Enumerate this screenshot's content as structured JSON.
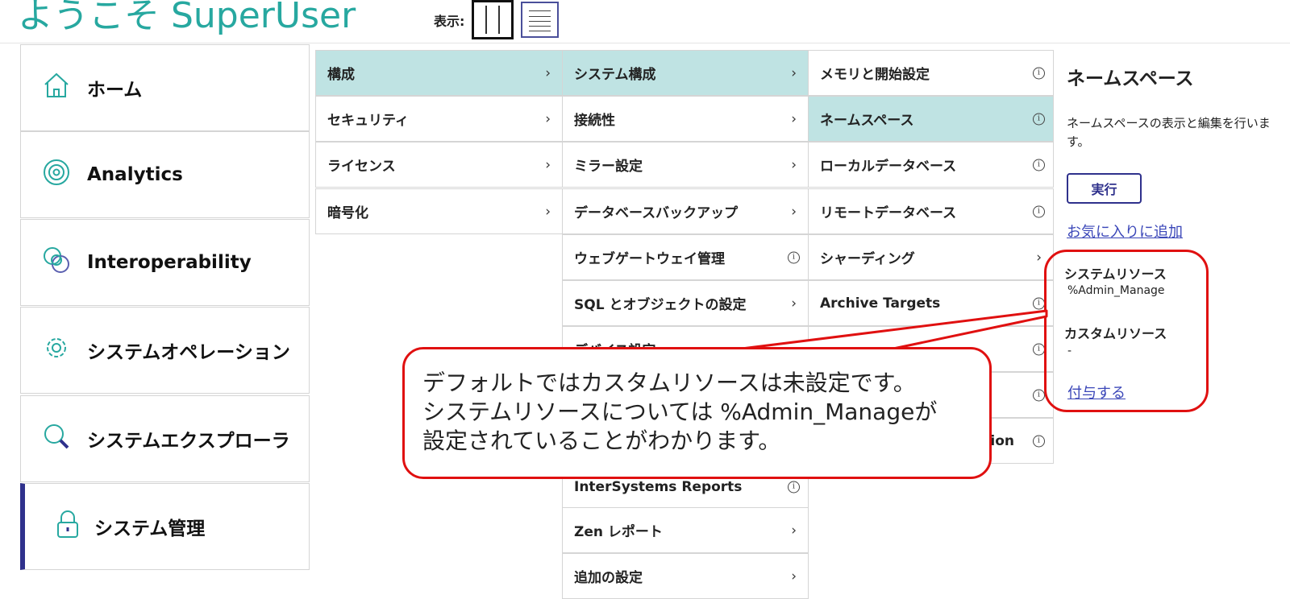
{
  "header": {
    "welcome": "ようこそ SuperUser",
    "view_label": "表示:"
  },
  "nav": [
    {
      "label": "ホーム",
      "icon": "home-icon"
    },
    {
      "label": "Analytics",
      "icon": "analytics-icon"
    },
    {
      "label": "Interoperability",
      "icon": "interoperability-icon"
    },
    {
      "label": "システムオペレーション",
      "icon": "gear-icon"
    },
    {
      "label": "システムエクスプローラ",
      "icon": "explorer-search-icon"
    },
    {
      "label": "システム管理",
      "icon": "lock-icon",
      "active": true
    }
  ],
  "col1": [
    {
      "label": "構成",
      "selected": true
    },
    {
      "label": "セキュリティ"
    },
    {
      "label": "ライセンス"
    },
    {
      "label": "暗号化"
    }
  ],
  "col2": [
    {
      "label": "システム構成",
      "selected": true
    },
    {
      "label": "接続性"
    },
    {
      "label": "ミラー設定"
    },
    {
      "label": "データベースバックアップ"
    },
    {
      "label": "ウェブゲートウェイ管理"
    },
    {
      "label": "SQL とオブジェクトの設定"
    },
    {
      "label": "デバイス設定"
    },
    {
      "label": ""
    },
    {
      "label": ""
    },
    {
      "label": "InterSystems Reports"
    },
    {
      "label": "Zen レポート"
    },
    {
      "label": "追加の設定"
    }
  ],
  "col3": [
    {
      "label": "メモリと開始設定"
    },
    {
      "label": "ネームスペース",
      "selected": true
    },
    {
      "label": "ローカルデータベース"
    },
    {
      "label": "リモートデータベース"
    },
    {
      "label": "シャーディング"
    },
    {
      "label": "Archive Targets"
    },
    {
      "label": ""
    },
    {
      "label": ""
    },
    {
      "label": "ion"
    }
  ],
  "detail": {
    "title": "ネームスペース",
    "description": "ネームスペースの表示と編集を行います。",
    "run_label": "実行",
    "favorite_label": "お気に入りに追加",
    "system_resource_heading": "システムリソース",
    "system_resource_value": "%Admin_Manage",
    "custom_resource_heading": "カスタムリソース",
    "custom_resource_value": "-",
    "grant_label": "付与する"
  },
  "annotation": {
    "line1": "デフォルトではカスタムリソースは未設定です。",
    "line2": "システムリソースについては %Admin_Manageが",
    "line3": "設定されていることがわかります。"
  },
  "colors": {
    "accent_teal": "#27a8a0",
    "selected_bg": "#bfe3e3",
    "primary": "#2f318c",
    "annotation_red": "#e01010"
  }
}
